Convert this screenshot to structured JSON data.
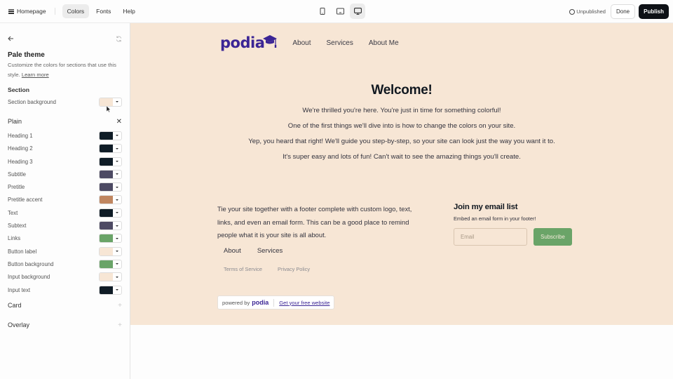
{
  "topbar": {
    "home_label": "Homepage",
    "tabs": [
      {
        "label": "Colors",
        "active": true
      },
      {
        "label": "Fonts",
        "active": false
      },
      {
        "label": "Help",
        "active": false
      }
    ],
    "devices": [
      "mobile-icon",
      "tablet-icon",
      "desktop-icon"
    ],
    "active_device": "desktop",
    "status": "Unpublished",
    "done_label": "Done",
    "publish_label": "Publish"
  },
  "sidebar": {
    "title": "Pale theme",
    "description": "Customize the colors for sections that use this style.",
    "learn_more": "Learn more",
    "section_heading": "Section",
    "section_rows": [
      {
        "label": "Section background",
        "color": "#f7e6d5"
      }
    ],
    "plain_heading": "Plain",
    "plain_rows": [
      {
        "label": "Heading 1",
        "color": "#0f1c26"
      },
      {
        "label": "Heading 2",
        "color": "#0f1c26"
      },
      {
        "label": "Heading 3",
        "color": "#0f1c26"
      },
      {
        "label": "Subtitle",
        "color": "#4d4a63"
      },
      {
        "label": "Pretitle",
        "color": "#4d4a63"
      },
      {
        "label": "Pretitle accent",
        "color": "#c08660"
      },
      {
        "label": "Text",
        "color": "#0f1c26"
      },
      {
        "label": "Subtext",
        "color": "#4d4a63"
      },
      {
        "label": "Links",
        "color": "#6aa468"
      },
      {
        "label": "Button label",
        "color": "#f7e6d5"
      },
      {
        "label": "Button background",
        "color": "#6aa468"
      },
      {
        "label": "Input background",
        "color": "#f7e6d5"
      },
      {
        "label": "Input text",
        "color": "#0f1c26"
      }
    ],
    "card_heading": "Card",
    "overlay_heading": "Overlay"
  },
  "site": {
    "logo": "podia",
    "nav": [
      "About",
      "Services",
      "About Me"
    ],
    "hero_title": "Welcome!",
    "hero_paragraphs": [
      "We're thrilled you're here. You're just in time for something colorful!",
      "One of the first things we'll dive into is how to change the colors on your site.",
      "Yep, you heard that right! We'll guide you step-by-step, so your site can look just the way you want it to.",
      "It's super easy and lots of fun! Can't wait to see the amazing things you'll create."
    ],
    "footer_text": "Tie your site together with a footer complete with custom logo, text, links, and even an email form. This can be a good place to remind people what it is your site is all about.",
    "footer_links": [
      "About",
      "Services"
    ],
    "legal_links": [
      "Terms of Service",
      "Privacy Policy"
    ],
    "email_heading": "Join my email list",
    "email_sub": "Embed an email form in your footer!",
    "email_placeholder": "Email",
    "subscribe_label": "Subscribe",
    "powered_by": "powered by",
    "powered_logo": "podia",
    "free_website": "Get your free website"
  }
}
